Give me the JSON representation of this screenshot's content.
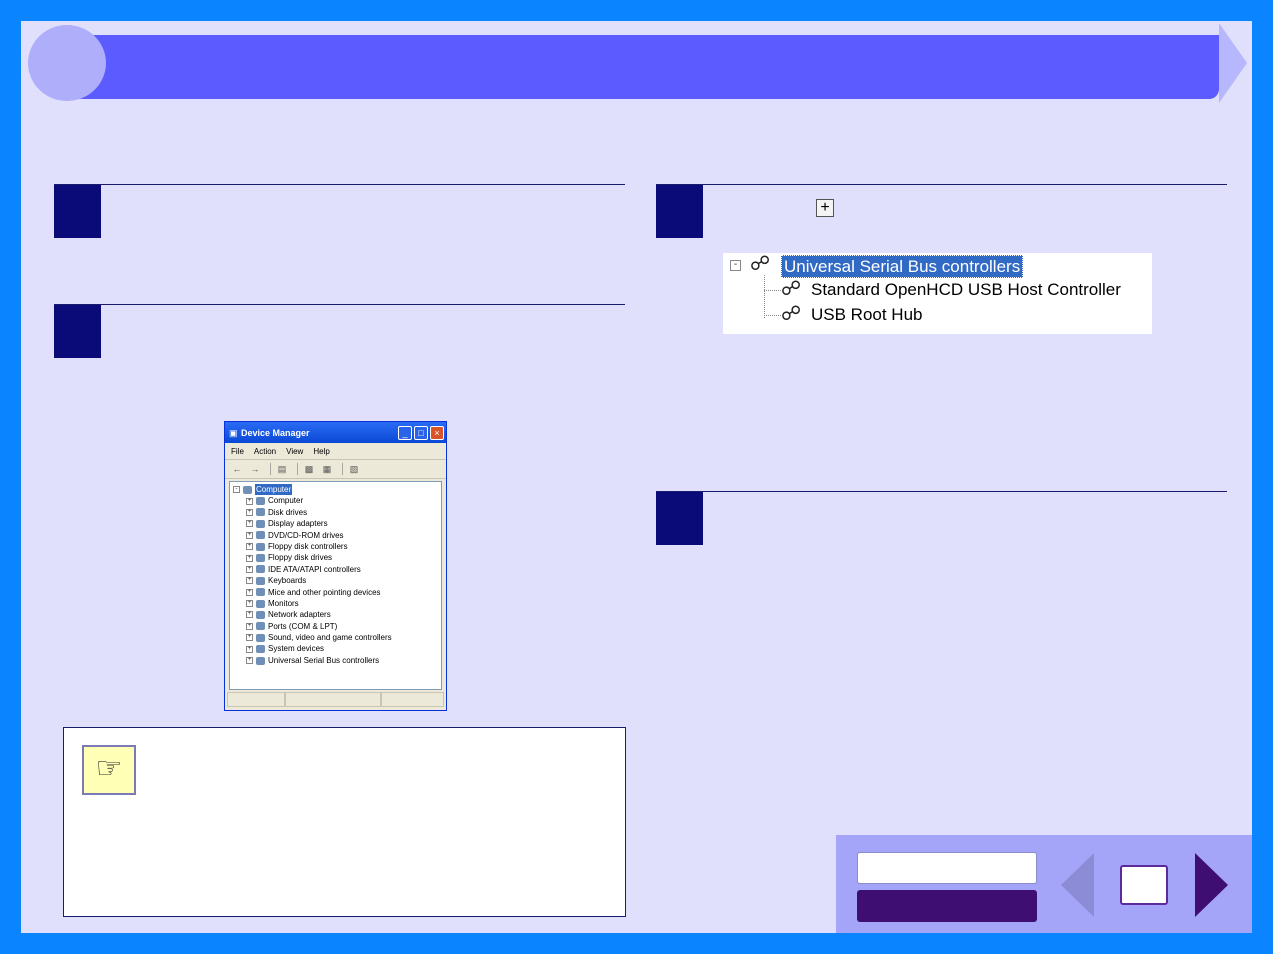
{
  "device_manager": {
    "title": "Device Manager",
    "menus": [
      "File",
      "Action",
      "View",
      "Help"
    ],
    "root": "Computer",
    "items": [
      "Computer",
      "Disk drives",
      "Display adapters",
      "DVD/CD-ROM drives",
      "Floppy disk controllers",
      "Floppy disk drives",
      "IDE ATA/ATAPI controllers",
      "Keyboards",
      "Mice and other pointing devices",
      "Monitors",
      "Network adapters",
      "Ports (COM & LPT)",
      "Sound, video and game controllers",
      "System devices",
      "Universal Serial Bus controllers"
    ]
  },
  "usb_panel": {
    "header": "Universal Serial Bus controllers",
    "children": [
      "Standard OpenHCD USB Host Controller",
      "USB Root Hub"
    ]
  },
  "icons": {
    "expand": "plus-box-icon",
    "usb": "usb-icon",
    "note": "pointing-hand-icon"
  },
  "colors": {
    "frame": "#0a84ff",
    "page_bg": "#e0e0fc",
    "header_bar": "#5b5bff",
    "step_box": "#0a0a78",
    "nav_dark": "#3e0e72",
    "nav_panel": "#a4a4f8"
  }
}
